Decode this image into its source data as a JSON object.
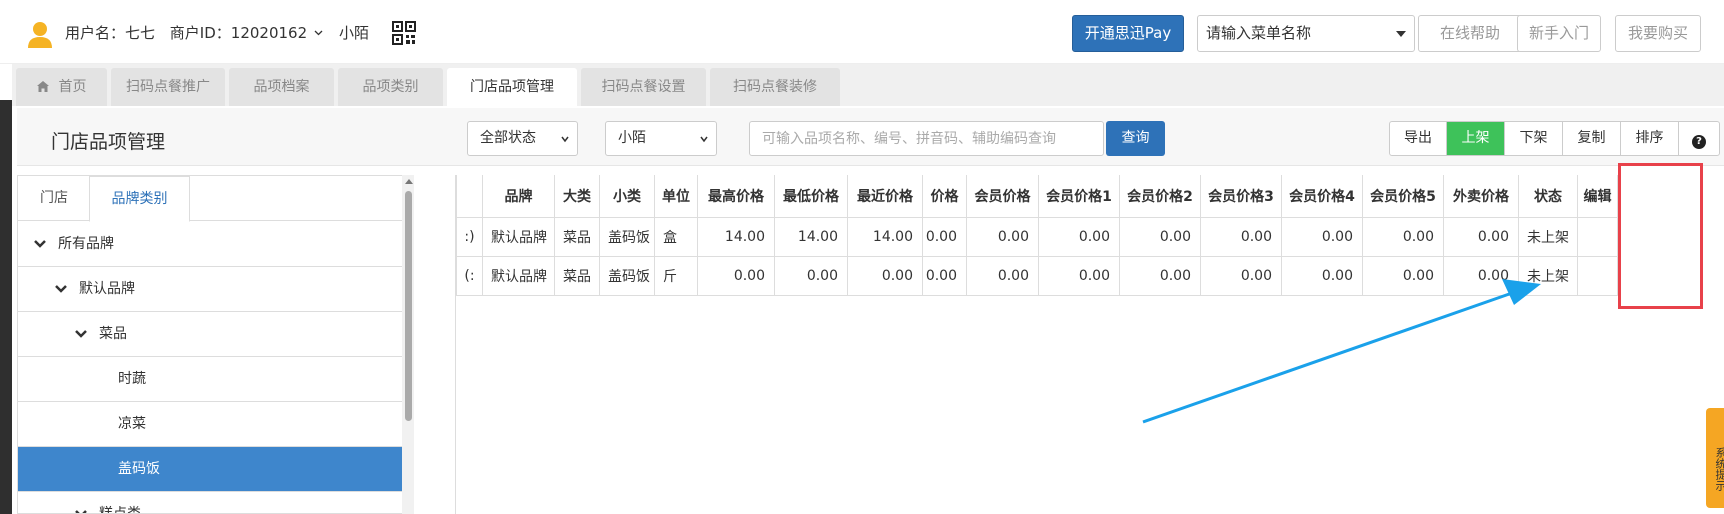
{
  "header": {
    "user_label": "用户名：七七",
    "merchant_label": "商户ID：12020162",
    "store_name": "小陌",
    "pay_button": "开通思迅Pay",
    "menu_search_placeholder": "请输入菜单名称",
    "help_button": "在线帮助",
    "beginner_button": "新手入门",
    "buy_button": "我要购买"
  },
  "tabs": [
    {
      "label": "首页"
    },
    {
      "label": "扫码点餐推广"
    },
    {
      "label": "品项档案"
    },
    {
      "label": "品项类别"
    },
    {
      "label": "门店品项管理"
    },
    {
      "label": "扫码点餐设置"
    },
    {
      "label": "扫码点餐装修"
    }
  ],
  "toolbar": {
    "title": "门店品项管理",
    "status_filter": "全部状态",
    "store_filter": "小陌",
    "search_placeholder": "可输入品项名称、编号、拼音码、辅助编码查询",
    "query_button": "查询",
    "actions": [
      "导出",
      "上架",
      "下架",
      "复制",
      "排序"
    ]
  },
  "tree": {
    "tabs": [
      "门店",
      "品牌类别"
    ],
    "items": [
      {
        "label": "所有品牌"
      },
      {
        "label": "默认品牌"
      },
      {
        "label": "菜品"
      },
      {
        "label": "时蔬"
      },
      {
        "label": "凉菜"
      },
      {
        "label": "盖码饭"
      },
      {
        "label": "糕点类"
      }
    ]
  },
  "table": {
    "columns": [
      "品牌",
      "大类",
      "小类",
      "单位",
      "最高价格",
      "最低价格",
      "最近价格",
      "价格",
      "会员价格",
      "会员价格1",
      "会员价格2",
      "会员价格3",
      "会员价格4",
      "会员价格5",
      "外卖价格",
      "状态",
      "编辑"
    ],
    "rows": [
      {
        "lead": ":)",
        "brand": "默认品牌",
        "category": "菜品",
        "subcategory": "盖码饭",
        "unit": "盒",
        "max": "14.00",
        "min": "14.00",
        "recent": "14.00",
        "price": "0.00",
        "vip": "0.00",
        "vip1": "0.00",
        "vip2": "0.00",
        "vip3": "0.00",
        "vip4": "0.00",
        "vip5": "0.00",
        "takeout": "0.00",
        "status": "未上架"
      },
      {
        "lead": "(:",
        "brand": "默认品牌",
        "category": "菜品",
        "subcategory": "盖码饭",
        "unit": "斤",
        "max": "0.00",
        "min": "0.00",
        "recent": "0.00",
        "price": "0.00",
        "vip": "0.00",
        "vip1": "0.00",
        "vip2": "0.00",
        "vip3": "0.00",
        "vip4": "0.00",
        "vip5": "0.00",
        "takeout": "0.00",
        "status": "未上架"
      }
    ]
  },
  "side_tip": "系统提示",
  "colors": {
    "primary": "#2e72b8",
    "green": "#3ec25a",
    "highlight": "#e8414a",
    "arrow": "#1aa1ea"
  }
}
